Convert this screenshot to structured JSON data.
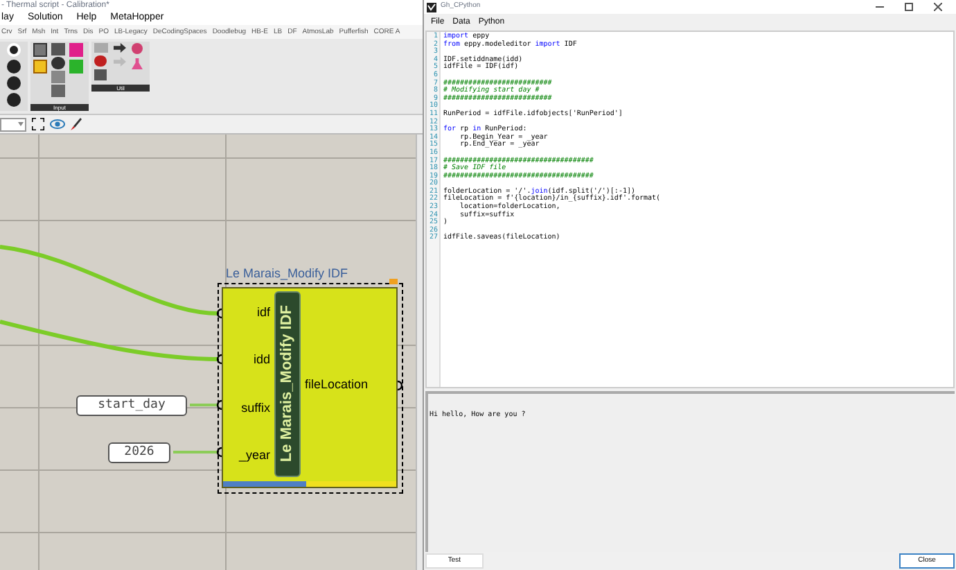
{
  "gh_window": {
    "title": "- Thermal script - Calibration*",
    "menu": [
      "lay",
      "Solution",
      "Help",
      "MetaHopper"
    ],
    "tabs": [
      {
        "label": "Crv"
      },
      {
        "label": "Srf"
      },
      {
        "label": "Msh"
      },
      {
        "label": "Int"
      },
      {
        "label": "Trns"
      },
      {
        "label": "Dis"
      },
      {
        "label": "PO"
      },
      {
        "label": "LB-Legacy"
      },
      {
        "label": "DeCodingSpaces"
      },
      {
        "label": "Doodlebug"
      },
      {
        "label": "HB-E"
      },
      {
        "label": "LB"
      },
      {
        "label": "DF"
      },
      {
        "label": "AtmosLab"
      },
      {
        "label": "Pufferfish"
      },
      {
        "label": "CORE A"
      }
    ],
    "ribbon_groups": [
      {
        "label": "Input"
      },
      {
        "label": "Util"
      }
    ]
  },
  "canvas": {
    "component": {
      "title": "Le Marais_Modify IDF",
      "nickname": "Le Marais_Modify IDF",
      "inputs": [
        "idf",
        "idd",
        "suffix",
        "_year"
      ],
      "outputs": [
        "fileLocation"
      ]
    },
    "panels": [
      {
        "text": "start_day"
      },
      {
        "text": "2026"
      }
    ]
  },
  "editor_window": {
    "title": "Gh_CPython",
    "menu": [
      "File",
      "Data",
      "Python"
    ],
    "code": [
      {
        "number": "1",
        "tokens": [
          {
            "kind": "keyword",
            "text": "import"
          },
          {
            "kind": "plain",
            "text": " eppy"
          }
        ]
      },
      {
        "number": "2",
        "tokens": [
          {
            "kind": "keyword",
            "text": "from"
          },
          {
            "kind": "plain",
            "text": " eppy.modeleditor "
          },
          {
            "kind": "keyword",
            "text": "import"
          },
          {
            "kind": "plain",
            "text": " IDF"
          }
        ]
      },
      {
        "number": "3"
      },
      {
        "number": "4",
        "tokens": [
          {
            "kind": "plain",
            "text": "IDF.setiddname(idd)"
          }
        ]
      },
      {
        "number": "5",
        "tokens": [
          {
            "kind": "plain",
            "text": "idfFile = IDF(idf)"
          }
        ]
      },
      {
        "number": "6"
      },
      {
        "number": "7",
        "tokens": [
          {
            "kind": "comment",
            "text": "##########################"
          }
        ]
      },
      {
        "number": "8",
        "tokens": [
          {
            "kind": "comment",
            "text": "# Modifying start day #"
          }
        ]
      },
      {
        "number": "9",
        "tokens": [
          {
            "kind": "comment",
            "text": "##########################"
          }
        ]
      },
      {
        "number": "10"
      },
      {
        "number": "11",
        "tokens": [
          {
            "kind": "plain",
            "text": "RunPeriod = idfFile.idfobjects['RunPeriod']"
          }
        ]
      },
      {
        "number": "12"
      },
      {
        "number": "13",
        "tokens": [
          {
            "kind": "keyword",
            "text": "for"
          },
          {
            "kind": "plain",
            "text": " rp "
          },
          {
            "kind": "keyword",
            "text": "in"
          },
          {
            "kind": "plain",
            "text": " RunPeriod:"
          }
        ]
      },
      {
        "number": "14",
        "tokens": [
          {
            "kind": "plain",
            "text": "    rp.Begin_Year = _year"
          }
        ]
      },
      {
        "number": "15",
        "tokens": [
          {
            "kind": "plain",
            "text": "    rp.End_Year = _year"
          }
        ]
      },
      {
        "number": "16"
      },
      {
        "number": "17",
        "tokens": [
          {
            "kind": "comment",
            "text": "####################################"
          }
        ]
      },
      {
        "number": "18",
        "tokens": [
          {
            "kind": "comment",
            "text": "# Save IDF file"
          }
        ]
      },
      {
        "number": "19",
        "tokens": [
          {
            "kind": "comment",
            "text": "####################################"
          }
        ]
      },
      {
        "number": "20"
      },
      {
        "number": "21",
        "tokens": [
          {
            "kind": "plain",
            "text": "folderLocation = '/'."
          },
          {
            "kind": "builtin",
            "text": "join"
          },
          {
            "kind": "plain",
            "text": "(idf.split('/')[:-1])"
          }
        ]
      },
      {
        "number": "22",
        "tokens": [
          {
            "kind": "plain",
            "text": "fileLocation = f'{location}/in_{suffix}.idf'.format("
          }
        ]
      },
      {
        "number": "23",
        "tokens": [
          {
            "kind": "plain",
            "text": "    location=folderLocation,"
          }
        ]
      },
      {
        "number": "24",
        "tokens": [
          {
            "kind": "plain",
            "text": "    suffix=suffix"
          }
        ]
      },
      {
        "number": "25",
        "tokens": [
          {
            "kind": "plain",
            "text": ")"
          }
        ]
      },
      {
        "number": "26"
      },
      {
        "number": "27",
        "tokens": [
          {
            "kind": "plain",
            "text": "idfFile.saveas(fileLocation)"
          }
        ]
      }
    ],
    "output": "Hi hello, How are you ?",
    "buttons": [
      "Test",
      "Close"
    ]
  }
}
